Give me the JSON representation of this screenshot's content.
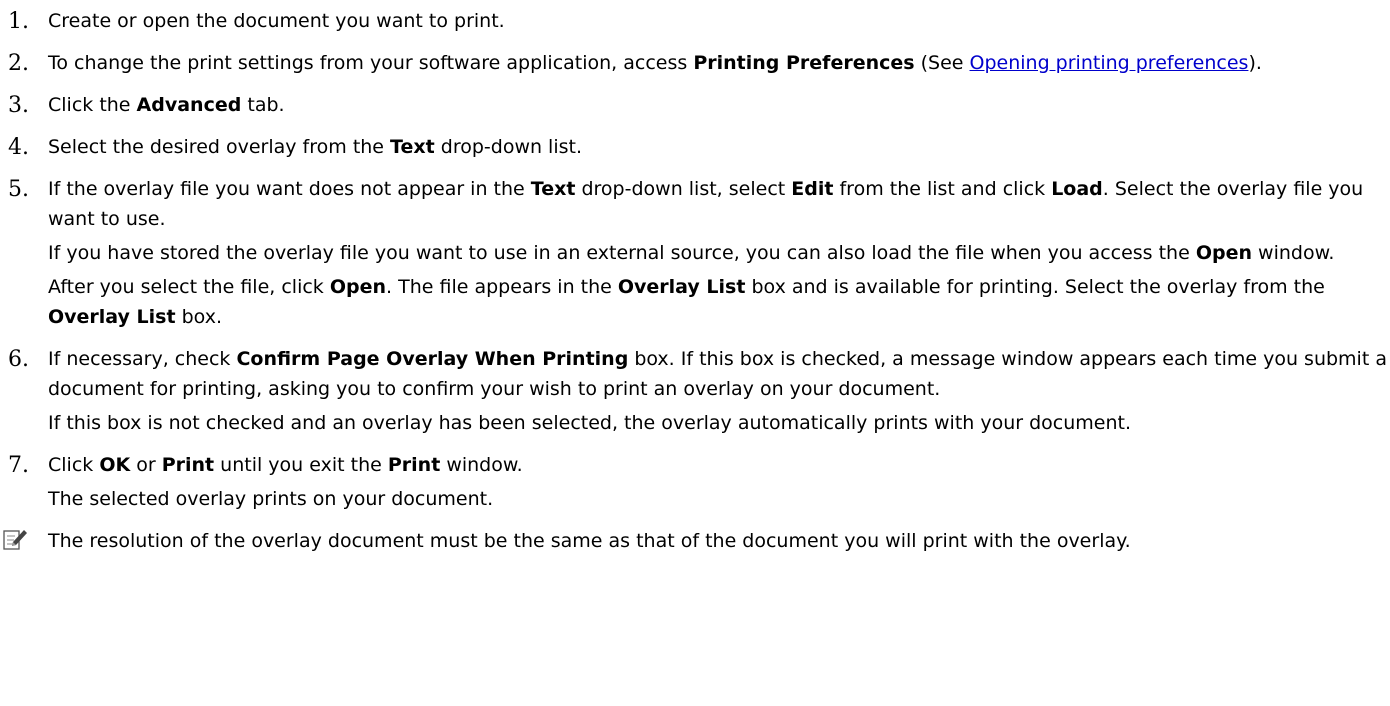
{
  "steps": [
    {
      "num": "1.",
      "paras": [
        [
          {
            "t": "Create or open the document you want to print."
          }
        ]
      ]
    },
    {
      "num": "2.",
      "paras": [
        [
          {
            "t": "To change the print settings from your software application, access "
          },
          {
            "t": "Printing Preferences",
            "b": true
          },
          {
            "t": " (See "
          },
          {
            "t": "Opening printing preferences",
            "link": true
          },
          {
            "t": ")."
          }
        ]
      ]
    },
    {
      "num": "3.",
      "paras": [
        [
          {
            "t": "Click the "
          },
          {
            "t": "Advanced",
            "b": true
          },
          {
            "t": " tab."
          }
        ]
      ]
    },
    {
      "num": "4.",
      "paras": [
        [
          {
            "t": "Select the desired overlay from the "
          },
          {
            "t": "Text",
            "b": true
          },
          {
            "t": " drop-down list."
          }
        ]
      ]
    },
    {
      "num": "5.",
      "paras": [
        [
          {
            "t": "If the overlay file you want does not appear in the "
          },
          {
            "t": "Text",
            "b": true
          },
          {
            "t": " drop-down list, select "
          },
          {
            "t": "Edit",
            "b": true
          },
          {
            "t": " from the list and click "
          },
          {
            "t": "Load",
            "b": true
          },
          {
            "t": ". Select the overlay file you want to use."
          }
        ],
        [
          {
            "t": "If you have stored the overlay file you want to use in an external source, you can also load the file when you access the "
          },
          {
            "t": "Open",
            "b": true
          },
          {
            "t": " window."
          }
        ],
        [
          {
            "t": "After you select the file, click "
          },
          {
            "t": "Open",
            "b": true
          },
          {
            "t": ". The file appears in the "
          },
          {
            "t": "Overlay List",
            "b": true
          },
          {
            "t": " box and is available for printing. Select the overlay from the "
          },
          {
            "t": "Overlay List",
            "b": true
          },
          {
            "t": " box."
          }
        ]
      ]
    },
    {
      "num": "6.",
      "paras": [
        [
          {
            "t": "If necessary, check "
          },
          {
            "t": "Confirm Page Overlay When Printing",
            "b": true
          },
          {
            "t": " box. If this box is checked, a message window appears each time you submit a document for printing, asking you to confirm your wish to print an overlay on your document."
          }
        ],
        [
          {
            "t": "If this box is not checked and an overlay has been selected, the overlay automatically prints with your document."
          }
        ]
      ]
    },
    {
      "num": "7.",
      "paras": [
        [
          {
            "t": "Click "
          },
          {
            "t": "OK",
            "b": true
          },
          {
            "t": " or "
          },
          {
            "t": "Print",
            "b": true
          },
          {
            "t": " until you exit the "
          },
          {
            "t": "Print",
            "b": true
          },
          {
            "t": " window."
          }
        ],
        [
          {
            "t": "The selected overlay prints on your document."
          }
        ]
      ]
    }
  ],
  "note": {
    "icon": "note-pencil-icon",
    "text": "The resolution of the overlay document must be the same as that of the document you will print with the overlay."
  },
  "colors": {
    "text": "#000000",
    "link": "#0000cc",
    "background": "#ffffff"
  }
}
